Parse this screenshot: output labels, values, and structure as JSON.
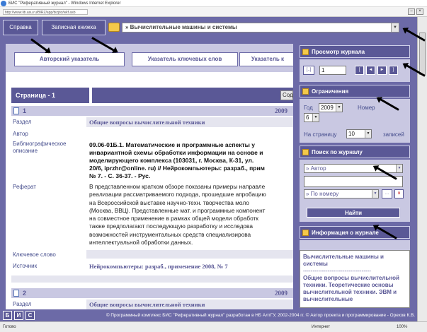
{
  "window": {
    "title": "БИС \"Реферативный журнал\" - Windows Internet Explorer",
    "address": "http://www.lib.asu.ru/BIRZ/app/bizjtic/wkf.asb"
  },
  "toolbar": {
    "help_label": "Справка",
    "notebook_label": "Записная книжка",
    "journal_value": "» Вычислительные машины и системы"
  },
  "indexes": {
    "author": "Авторский указатель",
    "keywords": "Указатель ключевых слов",
    "third": "Указатель к"
  },
  "page": {
    "header": "Страница - 1",
    "sod": "Сод"
  },
  "records": [
    {
      "num": "1",
      "year": "2009",
      "section_label": "Раздел",
      "section": "Общие вопросы вычислительной техники",
      "author_label": "Автор",
      "biblio_label": "Библиографическое описание",
      "biblio_lines": [
        "09.06-01Б.1. Математические и программные аспекты у",
        "инвариантной схемы обработки информации на основе и",
        "моделирующего комплекса (103031, г. Москва, К-31, ул.",
        "20/6, iprzhr@online. ru) // Нейрокомпьютеры: разраб., прим",
        "№ 7. - С. 36-37. - Рус."
      ],
      "abstract_label": "Реферат",
      "abstract_lines": [
        "В представленном кратком обзоре показаны примеры направле",
        "реализации рассматриваемого подхода, прошедшие апробацию",
        "на Всероссийской выставке научно-техн. творчества моло",
        "(Москва, ВВЦ). Представленные мат. и программные компонент",
        "на совместное применение в рамках общей модели обработк",
        "также предполагают последующую разработку и исследова",
        "возможностей инструментальных средств специализирова",
        "интеллектуальной обработки данных."
      ],
      "keyword_label": "Ключевое слово",
      "source_label": "Источник",
      "source": "Нейрокомпьютеры: разраб., применение 2008, № 7"
    },
    {
      "num": "2",
      "year": "2009",
      "section_label": "Раздел",
      "section": "Общие вопросы вычислительной техники"
    }
  ],
  "panel": {
    "view_title": "Просмотр журнала",
    "view_bracket": "[..]",
    "view_page": "1",
    "nav": [
      "[",
      "◄",
      "►",
      "]"
    ],
    "limits_title": "Ограничения",
    "year_label": "Год",
    "year_value": "2009",
    "number_label": "Номер",
    "number_value": "6",
    "perpage_label": "На страницу",
    "perpage_value": "10",
    "records_label": "записей",
    "search_title": "Поиск по журналу",
    "search_field": "» Автор",
    "search_input": "",
    "search_number": "» По номеру",
    "dots_label": "...",
    "clear_label": "x",
    "find_label": "Найти",
    "info_title": "Информация о журнале",
    "info_journal": "Вычислительные машины и системы",
    "info_divider": "------------------------------------",
    "info_sections": "Общие вопросы вычислительной техники. Теоретические основы вычислительной техники. ЭВМ и вычислительные"
  },
  "footer": {
    "b": "Б",
    "i": "И",
    "s": "С",
    "copyright": "© Программный комплекс БИС \"Реферативный журнал\" разработан в НБ АлтГУ, 2002-2004 гг. © Автор проекта и программирование - Орехов К.В."
  },
  "status": {
    "left": "Готово",
    "zone": "Интернет",
    "zoom": "100%"
  },
  "colors": {
    "frame": "#6c6aa7",
    "header": "#5a5896",
    "light": "#c9c8e2",
    "accent": "#444c8c"
  }
}
